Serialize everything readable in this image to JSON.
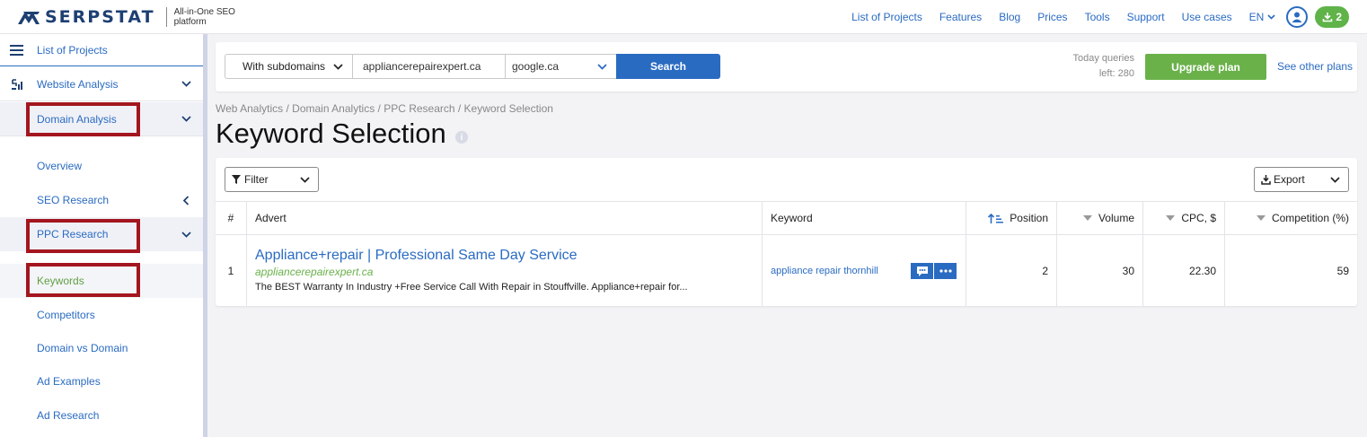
{
  "app": {
    "logo_text": "SERPSTAT",
    "logo_sub": "All-in-One SEO platform"
  },
  "topnav": {
    "items": [
      "List of Projects",
      "Features",
      "Blog",
      "Prices",
      "Tools",
      "Support",
      "Use cases"
    ],
    "lang": "EN",
    "downloads_count": "2"
  },
  "sidebar": {
    "list_of_projects": "List of Projects",
    "website_analysis": "Website Analysis",
    "domain_analysis": "Domain Analysis",
    "overview": "Overview",
    "seo_research": "SEO Research",
    "ppc_research": "PPC Research",
    "keywords": "Keywords",
    "competitors": "Competitors",
    "domain_vs_domain": "Domain vs Domain",
    "ad_examples": "Ad Examples",
    "ad_research": "Ad Research"
  },
  "search": {
    "subdomain_select": "With subdomains",
    "domain_value": "appliancerepairexpert.ca",
    "search_engine": "google.ca",
    "search_button": "Search",
    "queries_line1": "Today queries",
    "queries_line2": "left: 280",
    "upgrade_button": "Upgrade plan",
    "see_plans": "See other plans"
  },
  "breadcrumb": "Web Analytics / Domain Analytics / PPC Research / Keyword Selection",
  "page_title": "Keyword Selection",
  "toolbar": {
    "filter_label": "Filter",
    "export_label": "Export"
  },
  "table": {
    "headers": {
      "num": "#",
      "advert": "Advert",
      "keyword": "Keyword",
      "position": "Position",
      "volume": "Volume",
      "cpc": "CPC, $",
      "competition": "Competition (%)"
    },
    "rows": [
      {
        "num": "1",
        "ad_title": "Appliance+repair | Professional Same Day Service",
        "ad_url": "appliancerepairexpert.ca",
        "ad_desc": "The BEST Warranty In Industry +Free Service Call With Repair in Stouffville. Appliance+repair for...",
        "keyword": "appliance repair thornhill",
        "position": "2",
        "volume": "30",
        "cpc": "22.30",
        "competition": "59"
      }
    ]
  },
  "colors": {
    "brand_blue": "#2a6bc2",
    "brand_green": "#6ab14a",
    "highlight_red": "#a3161f"
  }
}
